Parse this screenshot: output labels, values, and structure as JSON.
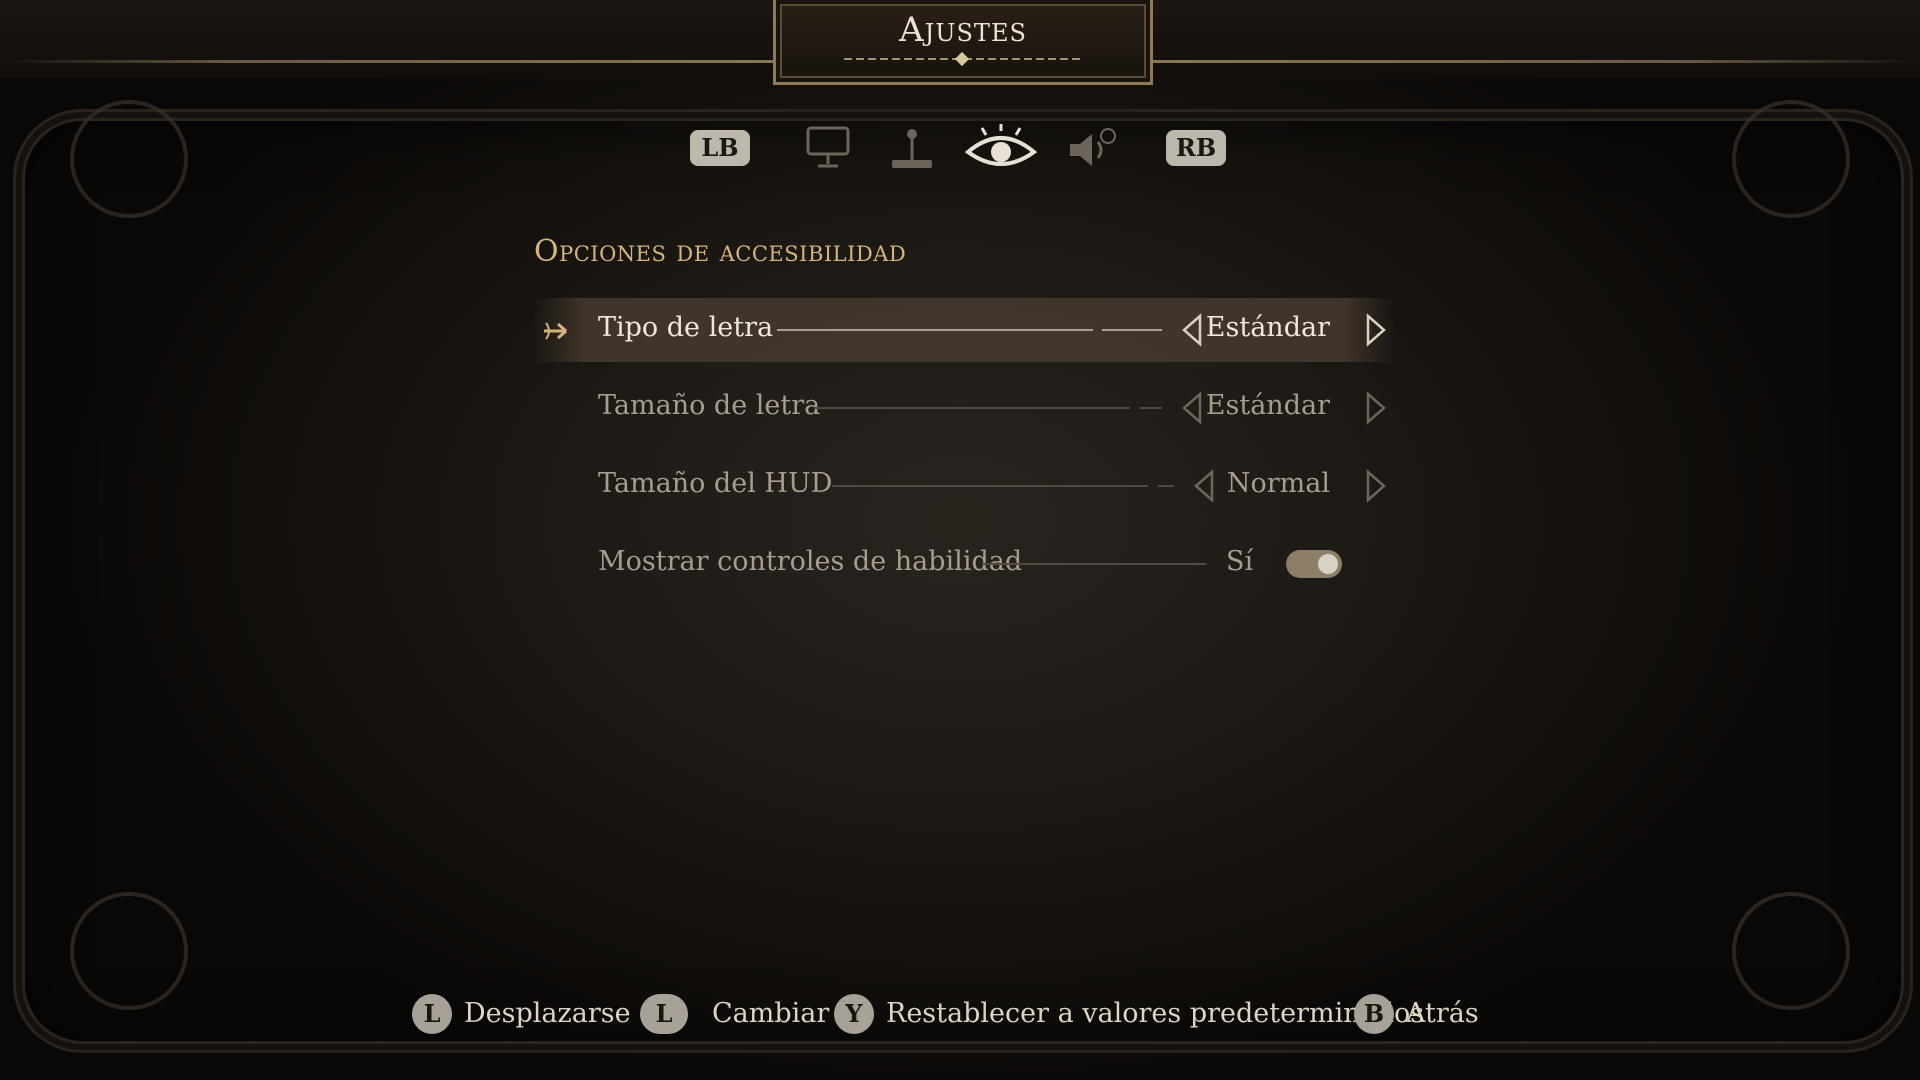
{
  "header": {
    "title": "Ajustes"
  },
  "tabs": {
    "left_bumper": "LB",
    "right_bumper": "RB",
    "icons": [
      "monitor-icon",
      "joystick-icon",
      "eye-icon",
      "speaker-icon"
    ],
    "active": "eye-icon"
  },
  "section": {
    "title": "Opciones de accesibilidad"
  },
  "settings": [
    {
      "label": "Tipo de letra",
      "value": "Estándar",
      "selected": true
    },
    {
      "label": "Tamaño de letra",
      "value": "Estándar",
      "selected": false
    },
    {
      "label": "Tamaño del HUD",
      "value": "Normal",
      "selected": false
    },
    {
      "label": "Mostrar controles de habilidad",
      "value": "Sí",
      "toggle_on": true,
      "selected": false
    }
  ],
  "footer": {
    "scroll": {
      "button": "L",
      "label": "Desplazarse"
    },
    "change": {
      "button": "L",
      "label": "Cambiar"
    },
    "reset": {
      "button": "Y",
      "label": "Restablecer a valores predeterminados"
    },
    "back": {
      "button": "B",
      "label": "Atrás"
    }
  },
  "colors": {
    "accent_gold": "#d6b37c",
    "selected_row": "#463a2e",
    "toggle_on": "#8d7f66"
  }
}
